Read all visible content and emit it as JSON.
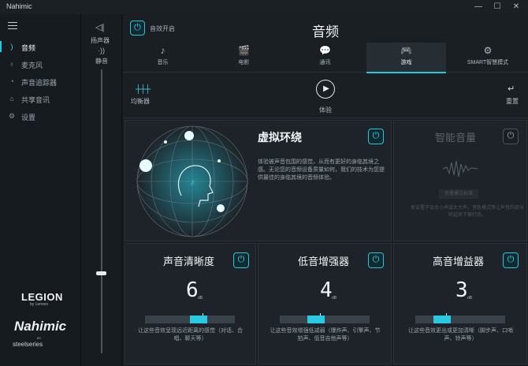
{
  "app": {
    "title": "Nahimic"
  },
  "window_controls": {
    "minimize": "—",
    "maximize": "☐",
    "close": "✕"
  },
  "sidebar": {
    "items": [
      {
        "label": "音频",
        "icon": "audio-icon",
        "active": true
      },
      {
        "label": "麦克风",
        "icon": "microphone-icon",
        "active": false
      },
      {
        "label": "声音追踪器",
        "icon": "sound-tracker-icon",
        "active": false
      },
      {
        "label": "共享音讯",
        "icon": "share-audio-icon",
        "active": false
      },
      {
        "label": "设置",
        "icon": "gear-icon",
        "active": false
      }
    ],
    "brand_legion": "LEGION",
    "brand_legion_sub": "by Lenovo",
    "brand_nahimic": "Nahimic",
    "brand_by": "BY",
    "brand_steelseries": "steelseries"
  },
  "device": {
    "label": "扬声器",
    "mute_label": "静音",
    "volume_percent": 29
  },
  "header": {
    "title": "音频",
    "effect_toggle_label": "音效开启"
  },
  "tabs": [
    {
      "label": "音乐",
      "icon": "music-note-icon",
      "active": false
    },
    {
      "label": "电影",
      "icon": "clapperboard-icon",
      "active": false
    },
    {
      "label": "通讯",
      "icon": "chat-bubble-icon",
      "active": false
    },
    {
      "label": "游戏",
      "icon": "gamepad-icon",
      "active": true
    },
    {
      "label": "SMART智慧模式",
      "icon": "smart-mode-icon",
      "active": false
    }
  ],
  "toolbar": {
    "equalizer_label": "均衡器",
    "experience_label": "体验",
    "reset_label": "重置"
  },
  "virtual_surround": {
    "title": "虚拟环绕",
    "description": "体验被声音包围的感觉，从而有更好的身临其境之感。无论您的音频设备质量如何，我们的技术为您提供最佳的身临其境的音频体验。"
  },
  "smart_volume": {
    "title": "智能音量",
    "button_label": "音量模式标准",
    "description": "使设置不会太小声或太大声，音轨模式等让声音的部分听起来下被打扰。"
  },
  "cards": [
    {
      "title": "声音清晰度",
      "value": "6",
      "unit": "dB",
      "level_fraction": 0.6,
      "description": "让这些音效呈现远近距离的感觉（对话、合唱、聊天等）"
    },
    {
      "title": "低音增强器",
      "value": "4",
      "unit": "dB",
      "level_fraction": 0.4,
      "description": "让这些音效增强低减弱（爆炸声、引擎声、节拍声、低音吉他声等）"
    },
    {
      "title": "高音增益器",
      "value": "3",
      "unit": "dB",
      "level_fraction": 0.3,
      "description": "让这些音效更出或更加清晰（脚步声、口哨声、铃声等）"
    }
  ],
  "colors": {
    "accent": "#29c3dc",
    "background": "#1a1f24",
    "sidebar": "#161b20"
  }
}
